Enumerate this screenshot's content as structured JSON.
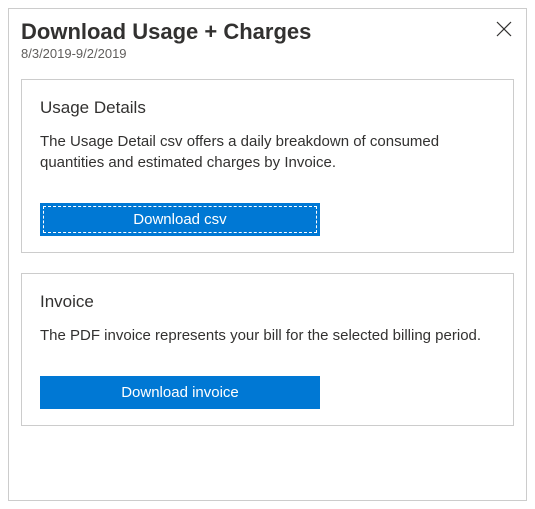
{
  "header": {
    "title": "Download Usage + Charges",
    "date_range": "8/3/2019-9/2/2019"
  },
  "cards": {
    "usage": {
      "title": "Usage Details",
      "description": "The Usage Detail csv offers a daily breakdown of consumed quantities and estimated charges by Invoice.",
      "button_label": "Download csv"
    },
    "invoice": {
      "title": "Invoice",
      "description": "The PDF invoice represents your bill for the selected billing period.",
      "button_label": "Download invoice"
    }
  },
  "colors": {
    "primary": "#0078d4"
  }
}
